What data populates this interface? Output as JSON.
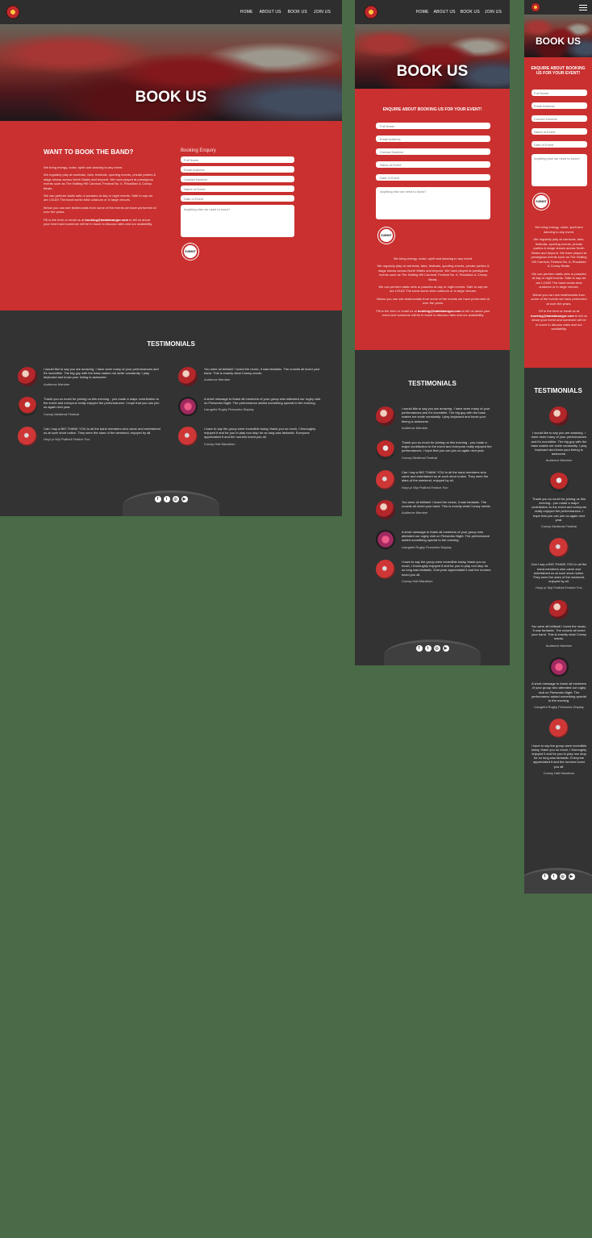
{
  "nav": {
    "items": [
      "HOME",
      "ABOUT US",
      "BOOK US",
      "JOIN US"
    ]
  },
  "hero": {
    "title": "BOOK US"
  },
  "about": {
    "heading": "WANT TO BOOK THE BAND?",
    "tablet_heading": "ENQUIRE ABOUT BOOKING US FOR YOUR EVENT!",
    "mobile_heading": "ENQUIRE ABOUT BOOKING US FOR YOUR EVENT!",
    "p1": "We bring energy, noise, spirit and dancing to any event.",
    "p2": "We regularly play at carnivals, fairs, festivals, sporting events, private parties & stage shows across North Wales and beyond. We have played at prestigious events such as The Notting Hill Carnival, Festival No. 6, Rhuddlan & Conwy Beats.",
    "p3": "We can perform static sets or parades at day or night events. Safe to say we are LOUD! The band works best outdoors or in large venues.",
    "p4": "Below you can see testimonials from some of the events we have performed at over the years.",
    "p5_before": "Fill in the form or email us at ",
    "email": "booking@batalabangor.com",
    "p5_after": " to tell us about your event and someone will be in touch to discuss rates and our availability."
  },
  "form": {
    "title": "Booking Enquiry",
    "full_name": "Full Name",
    "email": "Email Address",
    "contact": "Contact Number",
    "event_name": "Name of Event",
    "event_date": "Date of Event",
    "message": "Anything else we need to know?",
    "submit": "SUBMIT"
  },
  "testimonials": {
    "title": "TESTIMONIALS",
    "items": [
      {
        "quote": "I would like to say you are amazing. I have seen many of your performances and it's incredible. The big guy with the bass makes me smile constantly. I play keyboard and know your timing is awesome.",
        "name": "Audience Member"
      },
      {
        "quote": "Thank you so much for joining us this evening - you made a major contribution to the event and everyone really enjoyed the performances. I hope that you can join us again next year.",
        "name": "Conwy Medieval Festival"
      },
      {
        "quote": "Can I say a BIG THANK YOU to all the band members who came and entertained us at such short notice. They were the stars of the weekend, enjoyed by all.",
        "name": "Hwyl yr Wyl Pwllheli Festive Fun"
      },
      {
        "quote": "You were all brilliant! I loved the music, it was fantastic. The crowds all loved your band. This is exactly what Conwy needs.",
        "name": "Audience Member"
      },
      {
        "quote": "A short message to thank all members of your group who attended our rugby club on Fireworks Night. The performance added something special to the evening.",
        "name": "Llangefni Rugby Fireworks Display"
      },
      {
        "quote": "I have to say the group were incredible today, thank you so much, I thoroughly enjoyed it and for you to play non stop for so long was fantastic. Everyone appreciated it and the runners loved you all.",
        "name": "Conwy Half Marathon"
      }
    ]
  },
  "social": {
    "icons": [
      "facebook-icon",
      "twitter-icon",
      "instagram-icon",
      "youtube-icon"
    ],
    "glyphs": [
      "f",
      "t",
      "◎",
      "▶"
    ]
  },
  "colors": {
    "red": "#c9302f",
    "dark": "#333333",
    "page_bg": "#4a6b47"
  }
}
